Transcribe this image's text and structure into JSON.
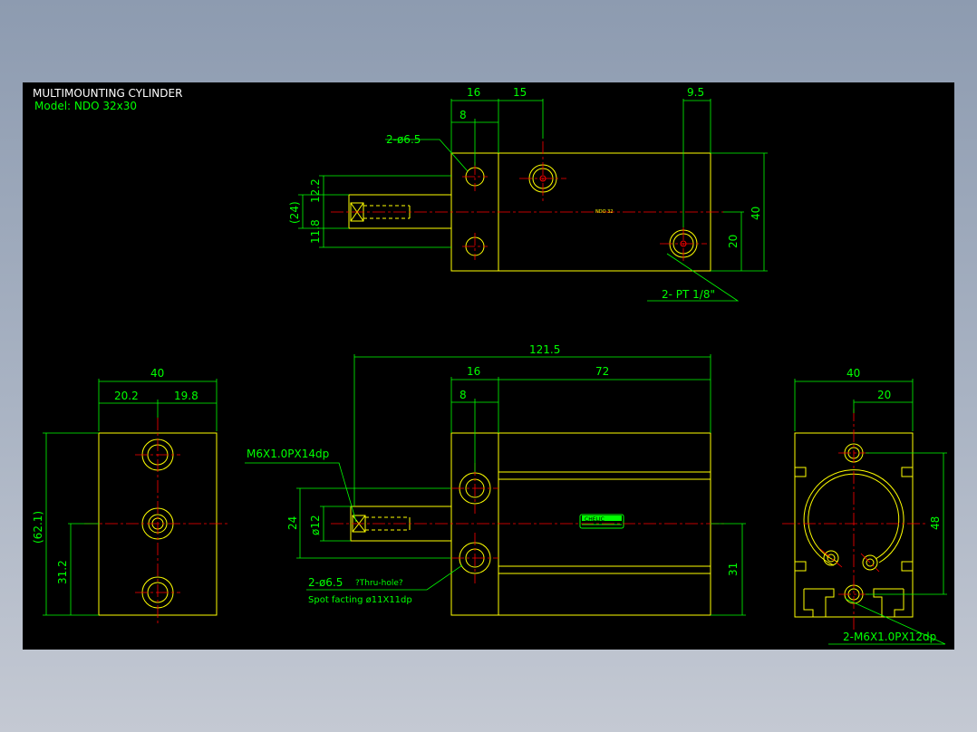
{
  "drawing": {
    "title": "MULTIMOUNTING CYLINDER",
    "model": "Model:  NDO 32x30",
    "colors": {
      "background": "#000000",
      "outline": "#ffff00",
      "dimension": "#00ff00",
      "centerline": "#ff0000",
      "title": "#ffffff",
      "window": "#8d9bb0"
    }
  },
  "top_view": {
    "dims": {
      "d16": "16",
      "d15": "15",
      "d9_5": "9.5",
      "d8": "8",
      "d12_2": "12.2",
      "d24": "(24)",
      "d11_8": "11.8",
      "d40": "40",
      "d20": "20"
    },
    "callouts": {
      "hole": "2-ø6.5",
      "port": "2- PT 1/8\""
    },
    "tag": "NDO 32"
  },
  "front_view": {
    "dims": {
      "overall": "121.5",
      "d16": "16",
      "d72": "72",
      "d8": "8",
      "d24": "24",
      "d12": "ø12",
      "d31": "31"
    },
    "callouts": {
      "thread": "M6X1.0PX14dp",
      "hole": "2-ø6.5",
      "hole_note": "?Thru-hole?",
      "spot": "Spot facting  ø11X11dp"
    },
    "nameplate": "CHELIC"
  },
  "left_view": {
    "dims": {
      "d40": "40",
      "d20_2": "20.2",
      "d19_8": "19.8",
      "d62_1": "(62.1)",
      "d31_2": "31.2"
    }
  },
  "right_view": {
    "dims": {
      "d40": "40",
      "d20": "20",
      "d48": "48"
    },
    "callouts": {
      "thread": "2-M6X1.0PX12dp"
    }
  }
}
